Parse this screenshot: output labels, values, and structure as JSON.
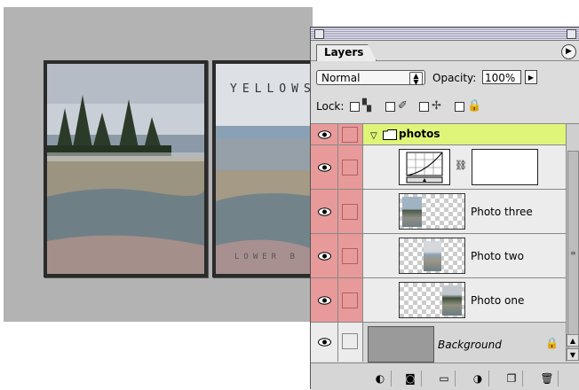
{
  "document": {
    "banner_top": "YELLOWS",
    "banner_bottom": "LOWER B"
  },
  "palette": {
    "tab_label": "Layers",
    "menu_icon": "play-triangle-icon",
    "blend_mode": "Normal",
    "opacity_label": "Opacity:",
    "opacity_value": "100%",
    "lock_label": "Lock:",
    "layers": [
      {
        "name": "photos",
        "type": "group",
        "visible": true,
        "expanded": true
      },
      {
        "name": "",
        "type": "adjustment-curves",
        "visible": true
      },
      {
        "name": "Photo three",
        "type": "pixel",
        "visible": true
      },
      {
        "name": "Photo two",
        "type": "pixel",
        "visible": true
      },
      {
        "name": "Photo one",
        "type": "pixel",
        "visible": true
      },
      {
        "name": "Background",
        "type": "background",
        "visible": true,
        "locked": true
      }
    ],
    "colors": {
      "group_highlight": "#dff57a",
      "link_column": "#e89a9a"
    },
    "bottom_buttons": [
      "layer-style-icon",
      "layer-mask-icon",
      "new-set-icon",
      "adjustment-layer-icon",
      "new-layer-icon",
      "trash-icon"
    ]
  }
}
